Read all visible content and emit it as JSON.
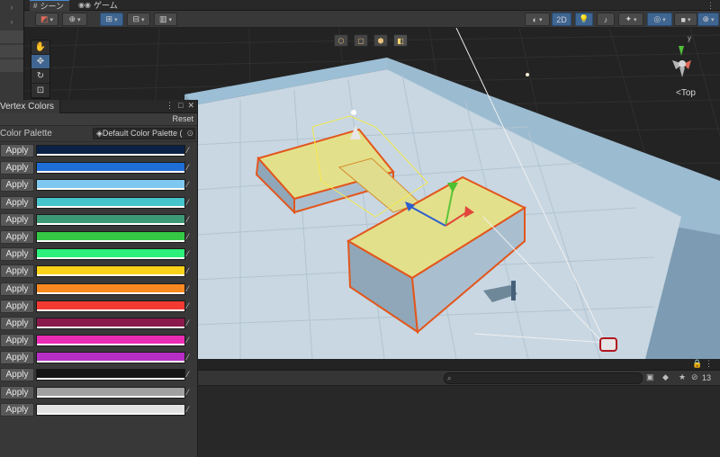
{
  "tabs": [
    {
      "label": "シーン",
      "icon": "hash-icon",
      "active": true
    },
    {
      "label": "ゲーム",
      "icon": "gamepad-icon",
      "active": false
    }
  ],
  "toolbar": {
    "mode_2d_label": "2D"
  },
  "scene": {
    "view_label": "<Top",
    "tools": [
      "hand-tool",
      "move-tool",
      "rotate-tool",
      "scale-tool",
      "rect-tool"
    ]
  },
  "panel": {
    "title": "Vertex Colors",
    "reset_label": "Reset",
    "palette_label": "Color Palette",
    "palette_value": "Default Color Palette (",
    "apply_label": "Apply",
    "colors": [
      "#0b2146",
      "#1e6ed6",
      "#7ec8f0",
      "#45c4cc",
      "#3e9977",
      "#35c845",
      "#2df07a",
      "#fbd21a",
      "#f88921",
      "#f23a32",
      "#8a1a4c",
      "#ea2cb4",
      "#b62ec4",
      "#151515",
      "#a0a0a0",
      "#e2e2e2"
    ]
  },
  "bottom": {
    "search_placeholder": "",
    "count_label": "13"
  }
}
